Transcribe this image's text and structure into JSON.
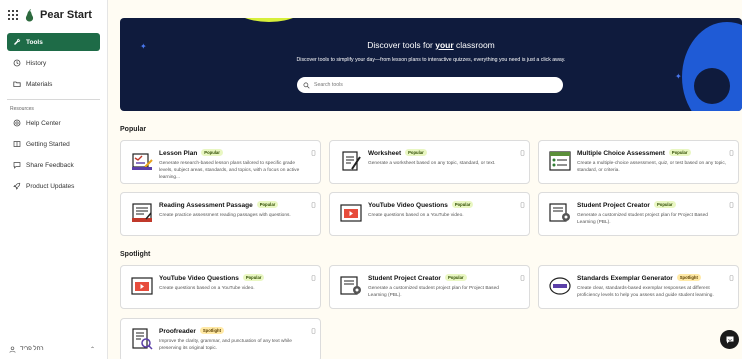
{
  "brand": {
    "name": "Pear Start"
  },
  "nav": {
    "primary": [
      {
        "label": "Tools",
        "icon": "wrench-icon",
        "active": true
      },
      {
        "label": "History",
        "icon": "history-icon"
      },
      {
        "label": "Materials",
        "icon": "folder-icon"
      }
    ],
    "resources_label": "Resources",
    "resources": [
      {
        "label": "Help Center",
        "icon": "help-icon"
      },
      {
        "label": "Getting Started",
        "icon": "book-icon"
      },
      {
        "label": "Share Feedback",
        "icon": "feedback-icon"
      },
      {
        "label": "Product Updates",
        "icon": "rocket-icon"
      }
    ],
    "user": {
      "name": "רחל פריד"
    }
  },
  "hero": {
    "title_prefix": "Discover tools for ",
    "title_emphasis": "your",
    "title_suffix": " classroom",
    "subtitle": "Discover tools to simplify your day—from lesson plans to interactive quizzes, everything you need is just a click away.",
    "search_placeholder": "Search tools"
  },
  "sections": {
    "popular": {
      "title": "Popular",
      "cards": [
        {
          "title": "Lesson Plan",
          "badge": "Popular",
          "desc": "Generate research-based lesson plans tailored to specific grade levels, subject areas, standards, and topics, with a focus on active learning..."
        },
        {
          "title": "Worksheet",
          "badge": "Popular",
          "desc": "Generate a worksheet based on any topic, standard, or text."
        },
        {
          "title": "Multiple Choice Assessment",
          "badge": "Popular",
          "desc": "Create a multiple-choice assessment, quiz, or test based on any topic, standard, or criteria."
        },
        {
          "title": "Reading Assessment Passage",
          "badge": "Popular",
          "desc": "Create practice assessment reading passages with questions."
        },
        {
          "title": "YouTube Video Questions",
          "badge": "Popular",
          "desc": "Create questions based on a YouTube video."
        },
        {
          "title": "Student Project Creator",
          "badge": "Popular",
          "desc": "Generate a customized student project plan for Project Based Learning (PBL)."
        }
      ]
    },
    "spotlight": {
      "title": "Spotlight",
      "cards": [
        {
          "title": "YouTube Video Questions",
          "badge": "Popular",
          "desc": "Create questions based on a YouTube video."
        },
        {
          "title": "Student Project Creator",
          "badge": "Popular",
          "desc": "Generate a customized student project plan for Project Based Learning (PBL)."
        },
        {
          "title": "Standards Exemplar Generator",
          "badge": "Spotlight",
          "desc": "Create clear, standards-based exemplar responses at different proficiency levels to help you assess and guide student learning."
        },
        {
          "title": "Proofreader",
          "badge": "Spotlight",
          "desc": "Improve the clarity, grammar, and punctuation of any text while preserving its original topic."
        }
      ]
    }
  },
  "colors": {
    "accent": "#1e6b47",
    "hero_bg": "#0f1b3d",
    "page_bg": "#fffcf3"
  }
}
